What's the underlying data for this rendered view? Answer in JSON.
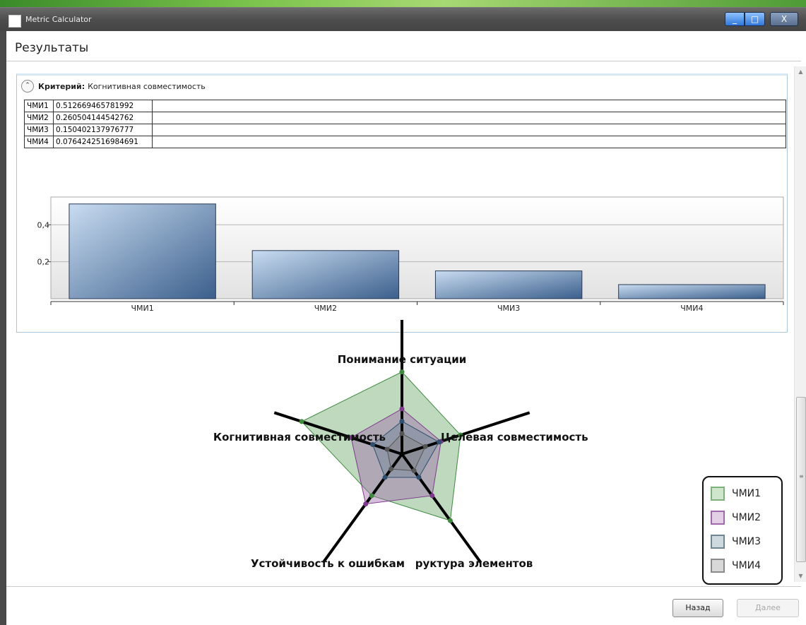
{
  "window": {
    "title": "Metric Calculator",
    "controls": {
      "minimize": "_",
      "maximize": "□",
      "close": "X"
    }
  },
  "page": {
    "title": "Результаты"
  },
  "criterion": {
    "label": "Критерий:",
    "name": "Когнитивная совместимость",
    "rows": [
      {
        "name": "ЧМИ1",
        "value": "0.512669465781992"
      },
      {
        "name": "ЧМИ2",
        "value": "0.260504144542762"
      },
      {
        "name": "ЧМИ3",
        "value": "0.150402137976777"
      },
      {
        "name": "ЧМИ4",
        "value": "0.0764242516984691"
      }
    ]
  },
  "chart_data": [
    {
      "type": "bar",
      "categories": [
        "ЧМИ1",
        "ЧМИ2",
        "ЧМИ3",
        "ЧМИ4"
      ],
      "values": [
        0.512669465781992,
        0.260504144542762,
        0.150402137976777,
        0.0764242516984691
      ],
      "y_ticks": [
        0.2,
        0.4
      ],
      "y_tick_labels": [
        "0,2",
        "0,4"
      ],
      "ylim": [
        0,
        0.55
      ],
      "bar_color": "#3b5f8c",
      "grid": true
    },
    {
      "type": "radar",
      "axes": [
        "Понимание ситуации",
        "Целевая совместимость",
        "Структура элементов",
        "Устойчивость к ошибкам",
        "Когнитивная совместимость"
      ],
      "axis_labels_shown": [
        "Понимание ситуации",
        "Целевая совместимость",
        "руктура элементов",
        "Устойчивость к ошибкам",
        "Когнитивная совместимость"
      ],
      "rmax": 0.55,
      "series": [
        {
          "name": "ЧМИ1",
          "values": [
            0.4,
            0.3,
            0.4,
            0.25,
            0.513
          ],
          "stroke": "#3f8a3f",
          "fill": "rgba(110,170,110,0.45)"
        },
        {
          "name": "ЧМИ2",
          "values": [
            0.22,
            0.2,
            0.25,
            0.3,
            0.26
          ],
          "stroke": "#7e3a8c",
          "fill": "rgba(160,110,170,0.45)"
        },
        {
          "name": "ЧМИ3",
          "values": [
            0.16,
            0.19,
            0.14,
            0.14,
            0.15
          ],
          "stroke": "#2f4f6f",
          "fill": "rgba(110,130,150,0.45)"
        },
        {
          "name": "ЧМИ4",
          "values": [
            0.1,
            0.12,
            0.1,
            0.09,
            0.076
          ],
          "stroke": "#555555",
          "fill": "rgba(130,130,130,0.45)"
        }
      ]
    }
  ],
  "legend": {
    "items": [
      {
        "name": "ЧМИ1",
        "fill": "#cfe6cc",
        "stroke": "#7fb27a"
      },
      {
        "name": "ЧМИ2",
        "fill": "#e3cfe6",
        "stroke": "#a16aab"
      },
      {
        "name": "ЧМИ3",
        "fill": "#ced9df",
        "stroke": "#6f8592"
      },
      {
        "name": "ЧМИ4",
        "fill": "#d8d8d8",
        "stroke": "#8a8a8a"
      }
    ]
  },
  "buttons": {
    "back": "Назад",
    "next": "Далее"
  }
}
